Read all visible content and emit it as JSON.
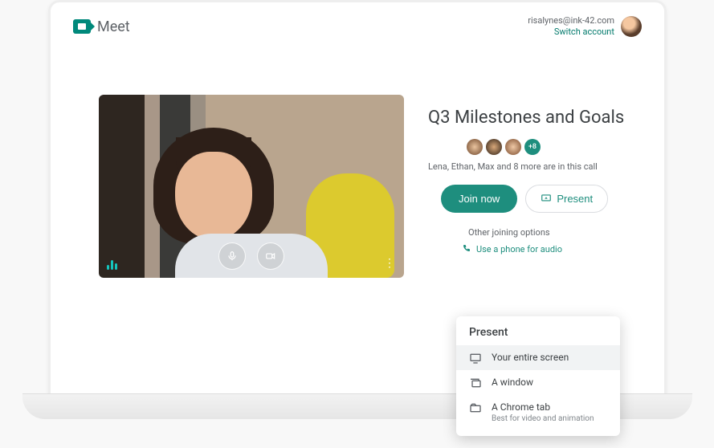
{
  "brand": {
    "name": "Meet"
  },
  "account": {
    "email": "risalynes@ink-42.com",
    "switch_label": "Switch account"
  },
  "meeting": {
    "title": "Q3 Milestones and Goals",
    "participants_overflow": "+8",
    "participants_text": "Lena, Ethan, Max and 8 more are in this call",
    "join_label": "Join now",
    "present_label": "Present",
    "other_options_label": "Other joining options",
    "phone_label": "Use a phone for audio"
  },
  "present_menu": {
    "title": "Present",
    "items": [
      {
        "label": "Your entire screen",
        "sub": ""
      },
      {
        "label": "A window",
        "sub": ""
      },
      {
        "label": "A Chrome tab",
        "sub": "Best for video and animation"
      }
    ]
  }
}
